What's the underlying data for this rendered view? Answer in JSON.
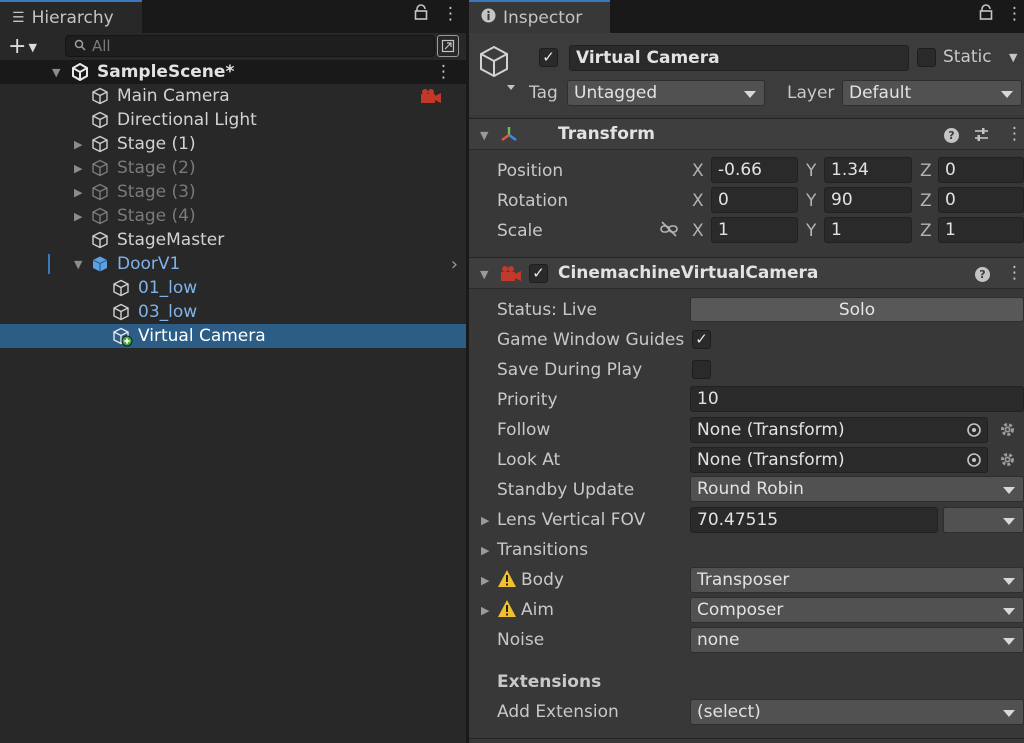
{
  "hierarchy": {
    "tab_label": "Hierarchy",
    "search_placeholder": "All",
    "scene_name": "SampleScene*",
    "items": [
      {
        "label": "Main Camera"
      },
      {
        "label": "Directional Light"
      },
      {
        "label": "Stage (1)"
      },
      {
        "label": "Stage (2)"
      },
      {
        "label": "Stage (3)"
      },
      {
        "label": "Stage (4)"
      },
      {
        "label": "StageMaster"
      },
      {
        "label": "DoorV1"
      },
      {
        "label": "01_low"
      },
      {
        "label": "03_low"
      },
      {
        "label": "Virtual Camera"
      }
    ]
  },
  "inspector": {
    "tab_label": "Inspector",
    "object_name": "Virtual Camera",
    "active": true,
    "static_label": "Static",
    "tag_label": "Tag",
    "tag_value": "Untagged",
    "layer_label": "Layer",
    "layer_value": "Default",
    "transform": {
      "title": "Transform",
      "position_label": "Position",
      "rotation_label": "Rotation",
      "scale_label": "Scale",
      "axis_x": "X",
      "axis_y": "Y",
      "axis_z": "Z",
      "position": {
        "x": "-0.66",
        "y": "1.34",
        "z": "0"
      },
      "rotation": {
        "x": "0",
        "y": "90",
        "z": "0"
      },
      "scale": {
        "x": "1",
        "y": "1",
        "z": "1"
      }
    },
    "vcam": {
      "title": "CinemachineVirtualCamera",
      "enabled": true,
      "status_label": "Status: Live",
      "solo_label": "Solo",
      "game_window_guides_label": "Game Window Guides",
      "game_window_guides": true,
      "save_during_play_label": "Save During Play",
      "save_during_play": false,
      "priority_label": "Priority",
      "priority_value": "10",
      "follow_label": "Follow",
      "follow_value": "None (Transform)",
      "look_at_label": "Look At",
      "look_at_value": "None (Transform)",
      "standby_update_label": "Standby Update",
      "standby_update_value": "Round Robin",
      "lens_fov_label": "Lens Vertical FOV",
      "lens_fov_value": "70.47515",
      "transitions_label": "Transitions",
      "body_label": "Body",
      "body_value": "Transposer",
      "aim_label": "Aim",
      "aim_value": "Composer",
      "noise_label": "Noise",
      "noise_value": "none",
      "extensions_label": "Extensions",
      "add_extension_label": "Add Extension",
      "add_extension_value": "(select)"
    }
  },
  "colors": {
    "selection": "#2c5d87",
    "accent": "#3a79bb",
    "prefab_text": "#7fb3ea",
    "warning": "#f0c030"
  },
  "icons": [
    "hierarchy-list-icon",
    "lock-icon",
    "kebab-menu-icon",
    "plus-icon",
    "search-icon",
    "scene-unity-icon",
    "gameobject-cube-icon",
    "prefab-cube-icon",
    "camera-gizmo-icon",
    "info-icon",
    "transform-axes-icon",
    "help-icon",
    "presets-icon",
    "constrain-proportions-icon",
    "cinemachine-icon",
    "target-picker-icon",
    "gear-icon",
    "warning-icon"
  ]
}
